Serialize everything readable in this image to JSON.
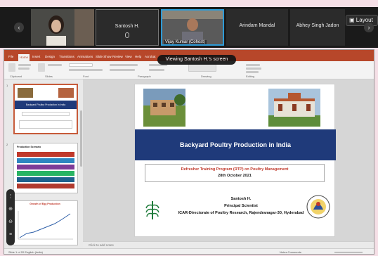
{
  "meeting": {
    "participants": [
      {
        "name": "Santosh H."
      },
      {
        "name": "Vijay Kumar (Cohost)"
      },
      {
        "name": "Arindam Mandal"
      },
      {
        "name": "Abhey Singh Jadon"
      }
    ],
    "layout_label": "Layout",
    "viewing_banner": "Viewing Santosh H.'s screen"
  },
  "powerpoint": {
    "menu": [
      "File",
      "Home",
      "Insert",
      "Design",
      "Transitions",
      "Animations",
      "Slide Show",
      "Review",
      "View",
      "Help",
      "Acrobat"
    ],
    "selected_menu": "Home",
    "ribbon_groups": [
      "Clipboard",
      "Slides",
      "Font",
      "Paragraph",
      "Drawing",
      "Editing"
    ],
    "thumbnails": [
      {
        "num": "1",
        "title": "Backyard Poultry Production in India"
      },
      {
        "num": "2",
        "title": "Production Scenario"
      },
      {
        "num": "3",
        "title": "Growth of Egg Production"
      }
    ],
    "notes_placeholder": "Click to add notes",
    "status_left": "Slide 1 of 20   English (India)",
    "status_right": "Notes  Comments"
  },
  "slide": {
    "title": "Backyard Poultry Production in India",
    "program": "Refresher Training Program (RTP) on Poultry Management",
    "date": "28th October 2021",
    "speaker": "Santosh H.",
    "designation": "Principal Scientist",
    "institute": "ICAR-Directorate of Poultry Research, Rajendranagar-30, Hyderabad"
  },
  "colors": {
    "accent": "#b7472a",
    "slide_band": "#1f3a7a",
    "active_speaker": "#2e9bd6"
  }
}
